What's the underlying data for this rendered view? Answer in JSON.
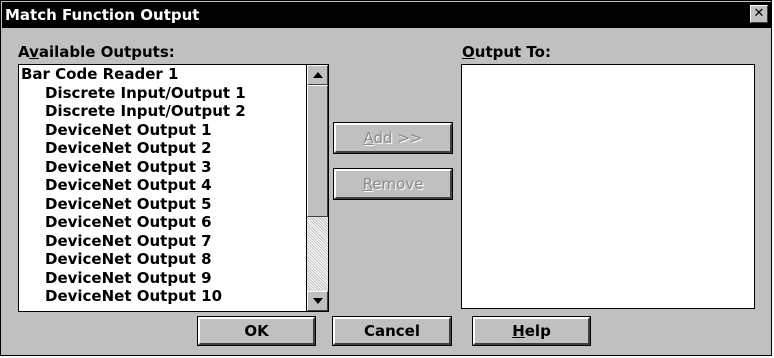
{
  "window": {
    "title": "Match Function Output",
    "close_glyph": "✕"
  },
  "available": {
    "label_prefix": "A",
    "label_mnemonic": "v",
    "label_suffix": "ailable Outputs:",
    "items": [
      {
        "label": "Bar Code Reader 1",
        "level": "group"
      },
      {
        "label": "Discrete Input/Output 1",
        "level": "child"
      },
      {
        "label": "Discrete Input/Output 2",
        "level": "child"
      },
      {
        "label": "DeviceNet Output 1",
        "level": "child"
      },
      {
        "label": "DeviceNet Output 2",
        "level": "child"
      },
      {
        "label": "DeviceNet Output 3",
        "level": "child"
      },
      {
        "label": "DeviceNet Output 4",
        "level": "child"
      },
      {
        "label": "DeviceNet Output 5",
        "level": "child"
      },
      {
        "label": "DeviceNet Output 6",
        "level": "child"
      },
      {
        "label": "DeviceNet Output 7",
        "level": "child"
      },
      {
        "label": "DeviceNet Output 8",
        "level": "child"
      },
      {
        "label": "DeviceNet Output 9",
        "level": "child"
      },
      {
        "label": "DeviceNet Output 10",
        "level": "child"
      }
    ]
  },
  "output": {
    "label_mnemonic": "O",
    "label_suffix": "utput To:",
    "items": []
  },
  "buttons": {
    "add_mnemonic": "A",
    "add_suffix": "dd >>",
    "remove_mnemonic": "R",
    "remove_suffix": "emove",
    "ok_label": "OK",
    "cancel_label": "Cancel",
    "help_mnemonic": "H",
    "help_suffix": "elp"
  },
  "colors": {
    "titlebar": "#000000",
    "face": "#c0c0c0",
    "list_bg": "#ffffff",
    "disabled_text": "#8a8a8a"
  }
}
